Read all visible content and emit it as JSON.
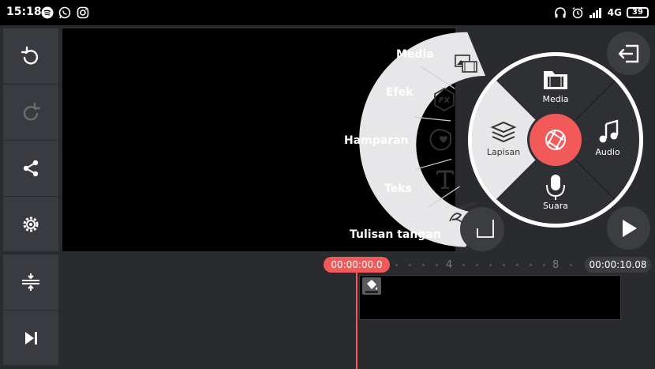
{
  "status_bar": {
    "time": "15:18",
    "network": "4G",
    "battery": "39",
    "left_icons": [
      "spotify-icon",
      "whatsapp-icon",
      "instagram-icon"
    ],
    "right_icons": [
      "headset-icon",
      "alarm-icon",
      "signal-icon"
    ]
  },
  "left_toolbar": {
    "top_items": [
      "undo-icon",
      "redo-icon",
      "share-icon",
      "settings-icon"
    ],
    "bottom_items": [
      "expand-timeline-icon",
      "skip-to-end-icon"
    ]
  },
  "layer_menu": {
    "items": [
      {
        "label": "Media",
        "icon": "media-layer-icon"
      },
      {
        "label": "Efek",
        "icon": "fx-icon"
      },
      {
        "label": "Hamparan",
        "icon": "sticker-icon"
      },
      {
        "label": "Teks",
        "icon": "text-icon"
      },
      {
        "label": "Tulisan tangan",
        "icon": "handwriting-icon"
      }
    ]
  },
  "wheel": {
    "media": "Media",
    "lapisan": "Lapisan",
    "audio": "Audio",
    "suara": "Suara"
  },
  "timeline": {
    "current_time": "00:00:00.0",
    "end_time": "00:00:10.08",
    "tick_4": "4",
    "tick_8": "8"
  },
  "colors": {
    "accent": "#f25a5a",
    "panel": "#3a3b40",
    "background": "#2a2b2f"
  }
}
